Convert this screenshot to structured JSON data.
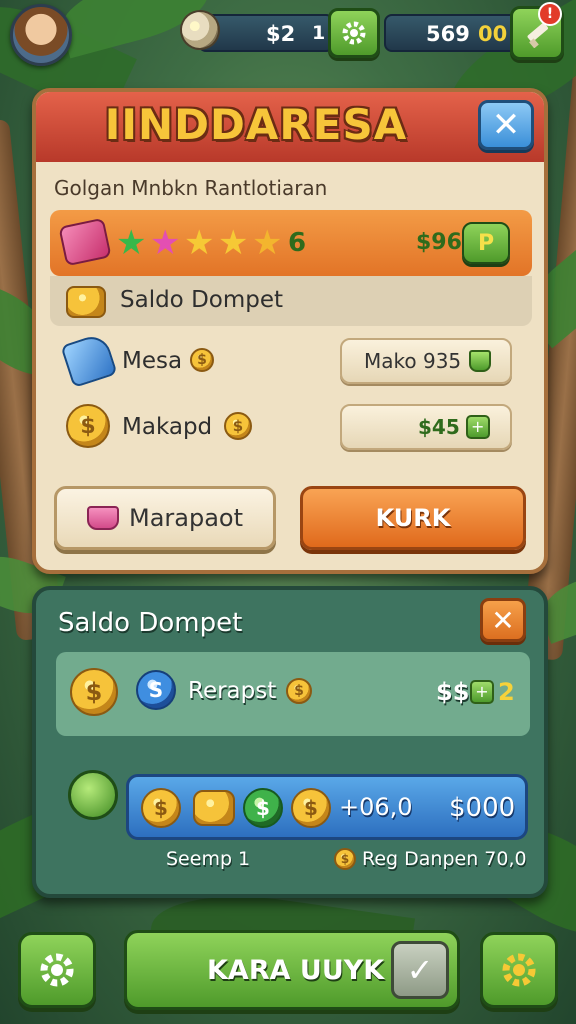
{
  "topbar": {
    "currency1": "$2",
    "currency1_count": "1",
    "currency2": "569",
    "currency2_suffix": "00",
    "notification_count": "!"
  },
  "shop_panel": {
    "title": "IINDDARESA",
    "subtitle": "Golgan Mnbkn Rantlotiaran",
    "star_count": "6",
    "price_top": "$96",
    "price_top_icon_text": "P",
    "wallet_label": "Saldo Dompet",
    "item1_label": "Mesa",
    "item1_button": "Mako 935",
    "item2_label": "Makapd",
    "item2_button": "$45",
    "item2_plus": "+",
    "secondary_button": "Marapaot",
    "primary_button": "KURK",
    "coin_symbol": "$"
  },
  "wallet_panel": {
    "title": "Saldo Dompet",
    "row_label": "Rerapst",
    "row_value": "$$",
    "row_plus": "+",
    "row_count": "2",
    "bar_value1": "+06,0",
    "bar_value2": "$000",
    "footer_left": "Seemp 1",
    "footer_right": "Reg Danpen 70,0",
    "coin_symbol": "$",
    "blue_coin_symbol": "S"
  },
  "bottom_bar": {
    "main_button": "KARA UUYK"
  },
  "colors": {
    "accent_green": "#4f9b2b",
    "accent_orange": "#e27427",
    "panel_red": "#b8392a",
    "panel_teal": "#3e7460"
  }
}
